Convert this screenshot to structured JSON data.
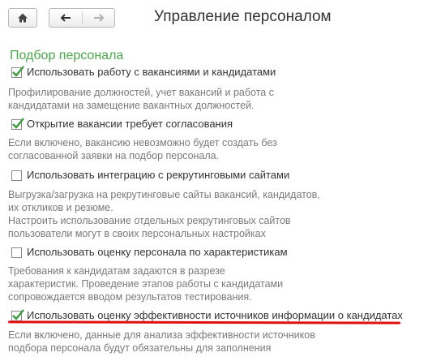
{
  "toolbar": {
    "home_icon": "home-icon",
    "back_icon": "arrow-left-icon",
    "forward_icon": "arrow-right-icon"
  },
  "header": {
    "title": "Управление персоналом"
  },
  "section": {
    "title": "Подбор персонала"
  },
  "options": [
    {
      "checked": true,
      "label": "Использовать работу с вакансиями и кандидатами",
      "description": [
        "Профилирование должностей, учет вакансий и работа с",
        "кандидатами на замещение вакантных должностей."
      ]
    },
    {
      "checked": true,
      "label": "Открытие вакансии требует согласования",
      "description": [
        "Если включено, вакансию невозможно будет создать без",
        "согласованной заявки на подбор персонала."
      ]
    },
    {
      "checked": false,
      "label": "Использовать интеграцию с рекрутинговыми сайтами",
      "description": [
        "Выгрузка/загрузка на рекрутинговые сайты вакансий, кандидатов,",
        "их откликов и резюме.",
        "Настроить использование отдельных рекрутинговых сайтов",
        "пользователи могут в своих персональных настройках"
      ]
    },
    {
      "checked": false,
      "label": "Использовать оценку персонала по характеристикам",
      "description": [
        "Требования к кандидатам задаются в разрезе",
        "характеристик. Проведение этапов работы с кандидатами",
        "сопровождается вводом результатов тестирования."
      ]
    },
    {
      "checked": true,
      "label": "Использовать оценку эффективности источников информации о кандидатах",
      "description": [
        "Если включено, данные для анализа эффективности источников",
        "подбора персонала будут обязательны для заполнения"
      ]
    }
  ],
  "colors": {
    "section": "#4aa74a",
    "check": "#3a9a3a",
    "highlight_underline": "#e01010"
  }
}
